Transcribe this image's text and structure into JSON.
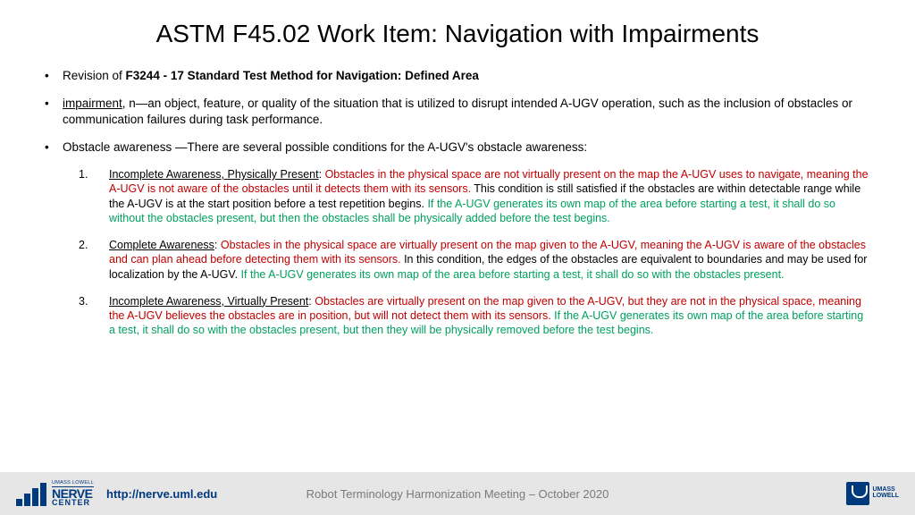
{
  "title": "ASTM F45.02 Work Item: Navigation with Impairments",
  "b1_pre": "Revision of ",
  "b1_bold": "F3244 - 17 Standard Test Method for Navigation: Defined Area",
  "b2_term": "impairment",
  "b2_rest": ", n—an object, feature, or quality of the situation that is utilized to disrupt intended A-UGV operation, such as the inclusion of obstacles or communication failures during task performance.",
  "b3": "Obstacle awareness —There are several possible conditions for the A-UGV's obstacle awareness:",
  "n1_title": "Incomplete Awareness, Physically Present",
  "n1_red": "Obstacles in the physical space are not virtually present on the map the A-UGV uses to navigate, meaning the A-UGV is not aware of the obstacles until it detects them with its sensors.",
  "n1_black": " This condition is still satisfied if the obstacles are within detectable range while the A-UGV is at the start position before a test repetition begins. ",
  "n1_green": "If the A-UGV generates its own map of the area before starting a test, it shall do so without the obstacles present, but then the obstacles shall be physically added before the test begins.",
  "n2_title": "Complete Awareness",
  "n2_red": "Obstacles in the physical space are virtually present on the map given to the A-UGV, meaning the A-UGV is aware of the obstacles and can plan ahead before detecting them with its sensors.",
  "n2_black": " In this condition, the edges of the obstacles are equivalent to boundaries and may be used for localization by the A-UGV. ",
  "n2_green": "If the A-UGV generates its own map of the area before starting a test, it shall do so with the obstacles present.",
  "n3_title": "Incomplete Awareness, Virtually Present",
  "n3_red": "Obstacles are virtually present on the map given to the A-UGV, but they are not in the physical space, meaning the A-UGV believes the obstacles are in position, but will not detect them with its sensors.",
  "n3_green": " If the A-UGV generates its own map of the area before starting a test, it shall do so with the obstacles present, but then they will be physically removed before the test begins.",
  "nerve_top": "UMASS LOWELL",
  "nerve_main": "NERVE",
  "nerve_sub": "CENTER",
  "url": "http://nerve.uml.edu",
  "footer_center": "Robot Terminology Harmonization Meeting – October 2020",
  "umass_l1": "UMASS",
  "umass_l2": "LOWELL"
}
